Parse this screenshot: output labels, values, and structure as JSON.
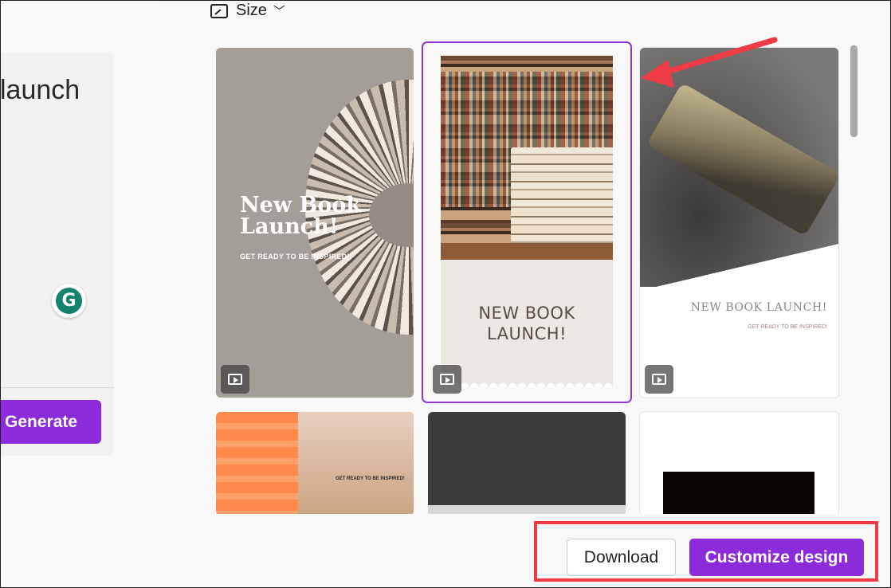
{
  "left_panel": {
    "prompt_text": "launch",
    "generate_label": "Generate",
    "grammarly_letter": "G"
  },
  "toolbar": {
    "size_label": "Size",
    "size_icon": "resize-icon",
    "chevron": "⌄"
  },
  "templates": [
    {
      "title": "New Book Launch!",
      "subtitle": "GET READY TO BE INSPIRED!",
      "has_video": true,
      "selected": false
    },
    {
      "title_line1": "NEW BOOK",
      "title_line2": "LAUNCH!",
      "has_video": true,
      "selected": true
    },
    {
      "title": "NEW BOOK LAUNCH!",
      "subtitle": "GET READY TO BE INSPIRED!",
      "has_video": true,
      "selected": false
    },
    {
      "subtitle": "GET READY TO BE INSPIRED!"
    },
    {},
    {}
  ],
  "actions": {
    "download_label": "Download",
    "customize_label": "Customize design"
  },
  "annotations": {
    "highlight_color": "#ef3b45",
    "accent_color": "#8b2bd9"
  }
}
